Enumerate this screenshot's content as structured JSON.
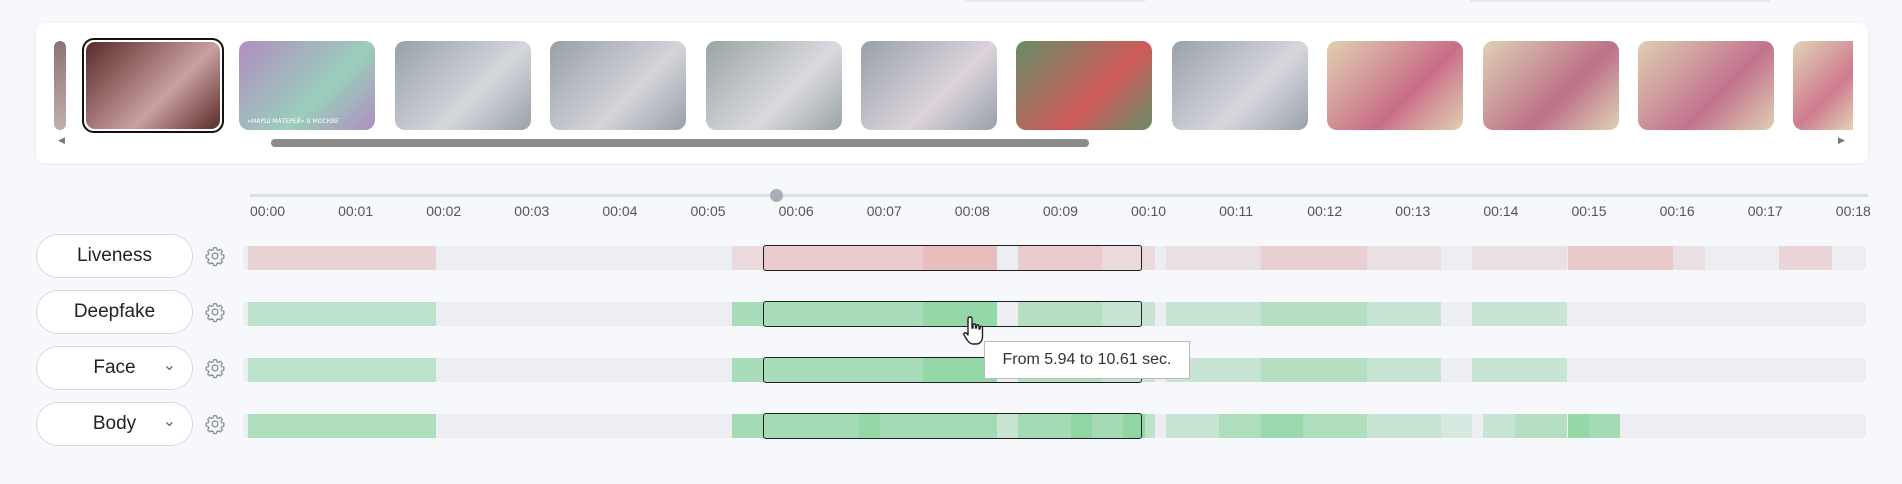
{
  "filmstrip": {
    "thumbnails": [
      {
        "alt": "crowd-indoor",
        "c1": "#5a2a2a",
        "c2": "#caa0a0",
        "selected": true
      },
      {
        "alt": "tv-presenter-woman",
        "c1": "#9a6fb0",
        "c2": "#7fc0a8",
        "selected": false,
        "caption": "«МАРШ МАТЕРЕЙ» В МОСКВЕ"
      },
      {
        "alt": "street-crowd-1",
        "c1": "#7a8590",
        "c2": "#c8ccd2",
        "selected": false
      },
      {
        "alt": "street-crowd-2",
        "c1": "#7a8590",
        "c2": "#c9c7cf",
        "selected": false
      },
      {
        "alt": "street-crowd-3",
        "c1": "#7d8a8a",
        "c2": "#cfcfd6",
        "selected": false
      },
      {
        "alt": "street-crowd-4",
        "c1": "#7a8590",
        "c2": "#d3c7d2",
        "selected": false
      },
      {
        "alt": "man-red-sweater",
        "c1": "#3b6d3b",
        "c2": "#c22b2b",
        "selected": false
      },
      {
        "alt": "street-crowd-5",
        "c1": "#7c8792",
        "c2": "#cccbd4",
        "selected": false
      },
      {
        "alt": "blonde-woman-1",
        "c1": "#d8c39a",
        "c2": "#b94566",
        "selected": false
      },
      {
        "alt": "blonde-woman-2",
        "c1": "#d6c49e",
        "c2": "#a94868",
        "selected": false
      },
      {
        "alt": "blonde-woman-3",
        "c1": "#d5c29b",
        "c2": "#b04b6d",
        "selected": false
      },
      {
        "alt": "blonde-woman-4",
        "c1": "#dac7a0",
        "c2": "#c0556f",
        "selected": false
      }
    ],
    "scroll_left_icon": "triangle-left-icon",
    "scroll_right_icon": "triangle-right-icon"
  },
  "timeline": {
    "ticks": [
      "00:00",
      "00:01",
      "00:02",
      "00:03",
      "00:04",
      "00:05",
      "00:06",
      "00:07",
      "00:08",
      "00:09",
      "00:10",
      "00:11",
      "00:12",
      "00:13",
      "00:14",
      "00:15",
      "00:16",
      "00:17",
      "00:18"
    ],
    "duration_visible_sec": 18.4,
    "playhead_sec": 5.94
  },
  "selection": {
    "from_sec": 5.94,
    "to_sec": 10.61
  },
  "rows": [
    {
      "label": "Liveness",
      "has_dropdown": false,
      "color": "#e7a9a9",
      "segments": [
        [
          0,
          0.18,
          0.4
        ],
        [
          0.46,
          0.49,
          0.28
        ],
        [
          0.49,
          0.64,
          0.5
        ],
        [
          0.64,
          0.71,
          0.7
        ],
        [
          0.73,
          0.81,
          0.5
        ],
        [
          0.81,
          0.86,
          0.3
        ],
        [
          0.87,
          0.96,
          0.2
        ],
        [
          0.96,
          1.06,
          0.45
        ],
        [
          1.06,
          1.13,
          0.2
        ],
        [
          1.16,
          1.25,
          0.2
        ],
        [
          1.25,
          1.35,
          0.55
        ],
        [
          1.35,
          1.38,
          0.2
        ],
        [
          1.45,
          1.5,
          0.35
        ]
      ]
    },
    {
      "label": "Deepfake",
      "has_dropdown": false,
      "color": "#86d39b",
      "segments": [
        [
          0,
          0.18,
          0.45
        ],
        [
          0.46,
          0.64,
          0.65
        ],
        [
          0.64,
          0.71,
          0.85
        ],
        [
          0.73,
          0.81,
          0.55
        ],
        [
          0.81,
          0.86,
          0.35
        ],
        [
          0.87,
          0.96,
          0.35
        ],
        [
          0.96,
          1.06,
          0.55
        ],
        [
          1.06,
          1.13,
          0.35
        ],
        [
          1.16,
          1.25,
          0.35
        ]
      ]
    },
    {
      "label": "Face",
      "has_dropdown": true,
      "color": "#86d39b",
      "segments": [
        [
          0,
          0.18,
          0.45
        ],
        [
          0.46,
          0.64,
          0.65
        ],
        [
          0.64,
          0.71,
          0.85
        ],
        [
          0.73,
          0.81,
          0.55
        ],
        [
          0.81,
          0.86,
          0.35
        ],
        [
          0.87,
          0.96,
          0.35
        ],
        [
          0.96,
          1.06,
          0.55
        ],
        [
          1.06,
          1.13,
          0.35
        ],
        [
          1.16,
          1.25,
          0.35
        ]
      ]
    },
    {
      "label": "Body",
      "has_dropdown": true,
      "color": "#86d39b",
      "segments": [
        [
          0,
          0.18,
          0.6
        ],
        [
          0.46,
          0.58,
          0.7
        ],
        [
          0.58,
          0.6,
          0.85
        ],
        [
          0.6,
          0.71,
          0.7
        ],
        [
          0.71,
          0.73,
          0.35
        ],
        [
          0.73,
          0.78,
          0.7
        ],
        [
          0.78,
          0.8,
          0.9
        ],
        [
          0.8,
          0.83,
          0.7
        ],
        [
          0.83,
          0.85,
          0.9
        ],
        [
          0.85,
          0.86,
          0.45
        ],
        [
          0.87,
          0.92,
          0.35
        ],
        [
          0.92,
          0.96,
          0.6
        ],
        [
          0.96,
          1.0,
          0.8
        ],
        [
          1.0,
          1.06,
          0.6
        ],
        [
          1.06,
          1.13,
          0.35
        ],
        [
          1.13,
          1.16,
          0.2
        ],
        [
          1.17,
          1.2,
          0.35
        ],
        [
          1.2,
          1.25,
          0.55
        ],
        [
          1.25,
          1.27,
          0.85
        ],
        [
          1.27,
          1.3,
          0.7
        ]
      ]
    }
  ],
  "tooltip": {
    "text": "From 5.94 to 10.61 sec."
  },
  "icons": {
    "settings": "gear-icon",
    "dropdown": "chevron-down-icon",
    "cursor": "hand-pointer-icon"
  }
}
